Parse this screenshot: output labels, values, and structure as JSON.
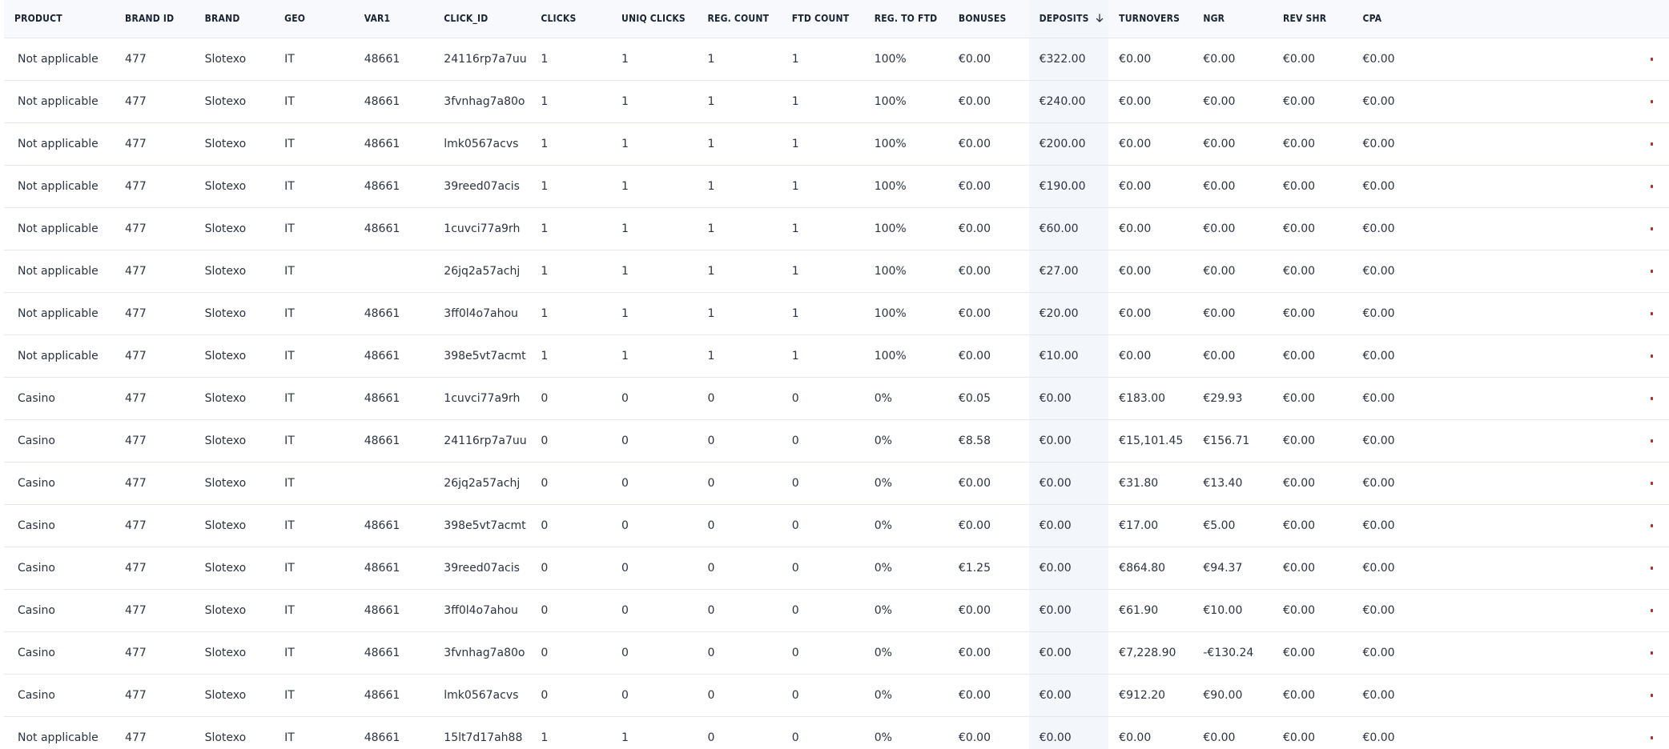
{
  "table": {
    "columns": [
      {
        "key": "product",
        "label": "PRODUCT"
      },
      {
        "key": "brand_id",
        "label": "BRAND ID"
      },
      {
        "key": "brand",
        "label": "BRAND"
      },
      {
        "key": "geo",
        "label": "GEO"
      },
      {
        "key": "var1",
        "label": "VAR1"
      },
      {
        "key": "click_id",
        "label": "CLICK_ID"
      },
      {
        "key": "clicks",
        "label": "CLICKS"
      },
      {
        "key": "uniq_clicks",
        "label": "UNIQ CLICKS"
      },
      {
        "key": "reg_count",
        "label": "REG. COUNT"
      },
      {
        "key": "ftd_count",
        "label": "FTD COUNT"
      },
      {
        "key": "reg_to_ftd",
        "label": "REG. TO FTD"
      },
      {
        "key": "bonuses",
        "label": "BONUSES"
      },
      {
        "key": "deposits",
        "label": "DEPOSITS",
        "sorted": "desc"
      },
      {
        "key": "turnovers",
        "label": "TURNOVERS"
      },
      {
        "key": "ngr",
        "label": "NGR"
      },
      {
        "key": "rev_shr",
        "label": "REV SHR"
      },
      {
        "key": "cpa",
        "label": "CPA"
      },
      {
        "key": "extra",
        "label": ""
      }
    ],
    "rows": [
      [
        "Not applicable",
        "477",
        "Slotexo",
        "IT",
        "48661",
        "24116rp7a7uu",
        "1",
        "1",
        "1",
        "1",
        "100%",
        "€0.00",
        "€322.00",
        "€0.00",
        "€0.00",
        "€0.00",
        "€0.00"
      ],
      [
        "Not applicable",
        "477",
        "Slotexo",
        "IT",
        "48661",
        "3fvnhag7a80o",
        "1",
        "1",
        "1",
        "1",
        "100%",
        "€0.00",
        "€240.00",
        "€0.00",
        "€0.00",
        "€0.00",
        "€0.00"
      ],
      [
        "Not applicable",
        "477",
        "Slotexo",
        "IT",
        "48661",
        "lmk0567acvs",
        "1",
        "1",
        "1",
        "1",
        "100%",
        "€0.00",
        "€200.00",
        "€0.00",
        "€0.00",
        "€0.00",
        "€0.00"
      ],
      [
        "Not applicable",
        "477",
        "Slotexo",
        "IT",
        "48661",
        "39reed07acis",
        "1",
        "1",
        "1",
        "1",
        "100%",
        "€0.00",
        "€190.00",
        "€0.00",
        "€0.00",
        "€0.00",
        "€0.00"
      ],
      [
        "Not applicable",
        "477",
        "Slotexo",
        "IT",
        "48661",
        "1cuvci77a9rh",
        "1",
        "1",
        "1",
        "1",
        "100%",
        "€0.00",
        "€60.00",
        "€0.00",
        "€0.00",
        "€0.00",
        "€0.00"
      ],
      [
        "Not applicable",
        "477",
        "Slotexo",
        "IT",
        "",
        "26jq2a57achj",
        "1",
        "1",
        "1",
        "1",
        "100%",
        "€0.00",
        "€27.00",
        "€0.00",
        "€0.00",
        "€0.00",
        "€0.00"
      ],
      [
        "Not applicable",
        "477",
        "Slotexo",
        "IT",
        "48661",
        "3ff0l4o7ahou",
        "1",
        "1",
        "1",
        "1",
        "100%",
        "€0.00",
        "€20.00",
        "€0.00",
        "€0.00",
        "€0.00",
        "€0.00"
      ],
      [
        "Not applicable",
        "477",
        "Slotexo",
        "IT",
        "48661",
        "398e5vt7acmt",
        "1",
        "1",
        "1",
        "1",
        "100%",
        "€0.00",
        "€10.00",
        "€0.00",
        "€0.00",
        "€0.00",
        "€0.00"
      ],
      [
        "Casino",
        "477",
        "Slotexo",
        "IT",
        "48661",
        "1cuvci77a9rh",
        "0",
        "0",
        "0",
        "0",
        "0%",
        "€0.05",
        "€0.00",
        "€183.00",
        "€29.93",
        "€0.00",
        "€0.00"
      ],
      [
        "Casino",
        "477",
        "Slotexo",
        "IT",
        "48661",
        "24116rp7a7uu",
        "0",
        "0",
        "0",
        "0",
        "0%",
        "€8.58",
        "€0.00",
        "€15,101.45",
        "€156.71",
        "€0.00",
        "€0.00"
      ],
      [
        "Casino",
        "477",
        "Slotexo",
        "IT",
        "",
        "26jq2a57achj",
        "0",
        "0",
        "0",
        "0",
        "0%",
        "€0.00",
        "€0.00",
        "€31.80",
        "€13.40",
        "€0.00",
        "€0.00"
      ],
      [
        "Casino",
        "477",
        "Slotexo",
        "IT",
        "48661",
        "398e5vt7acmt",
        "0",
        "0",
        "0",
        "0",
        "0%",
        "€0.00",
        "€0.00",
        "€17.00",
        "€5.00",
        "€0.00",
        "€0.00"
      ],
      [
        "Casino",
        "477",
        "Slotexo",
        "IT",
        "48661",
        "39reed07acis",
        "0",
        "0",
        "0",
        "0",
        "0%",
        "€1.25",
        "€0.00",
        "€864.80",
        "€94.37",
        "€0.00",
        "€0.00"
      ],
      [
        "Casino",
        "477",
        "Slotexo",
        "IT",
        "48661",
        "3ff0l4o7ahou",
        "0",
        "0",
        "0",
        "0",
        "0%",
        "€0.00",
        "€0.00",
        "€61.90",
        "€10.00",
        "€0.00",
        "€0.00"
      ],
      [
        "Casino",
        "477",
        "Slotexo",
        "IT",
        "48661",
        "3fvnhag7a80o",
        "0",
        "0",
        "0",
        "0",
        "0%",
        "€0.00",
        "€0.00",
        "€7,228.90",
        "-€130.24",
        "€0.00",
        "€0.00"
      ],
      [
        "Casino",
        "477",
        "Slotexo",
        "IT",
        "48661",
        "lmk0567acvs",
        "0",
        "0",
        "0",
        "0",
        "0%",
        "€0.00",
        "€0.00",
        "€912.20",
        "€90.00",
        "€0.00",
        "€0.00"
      ],
      [
        "Not applicable",
        "477",
        "Slotexo",
        "IT",
        "48661",
        "15lt7d17ah88",
        "1",
        "1",
        "0",
        "0",
        "0%",
        "€0.00",
        "€0.00",
        "€0.00",
        "€0.00",
        "€0.00",
        "€0.00"
      ]
    ]
  },
  "colors": {
    "header_bg": "#f7f9fc",
    "sorted_col_bg": "#f3f7fc",
    "border": "#e3e8ef",
    "edge_marker": "#b42b2b"
  },
  "icons": {
    "sort": "arrow-down-icon"
  }
}
